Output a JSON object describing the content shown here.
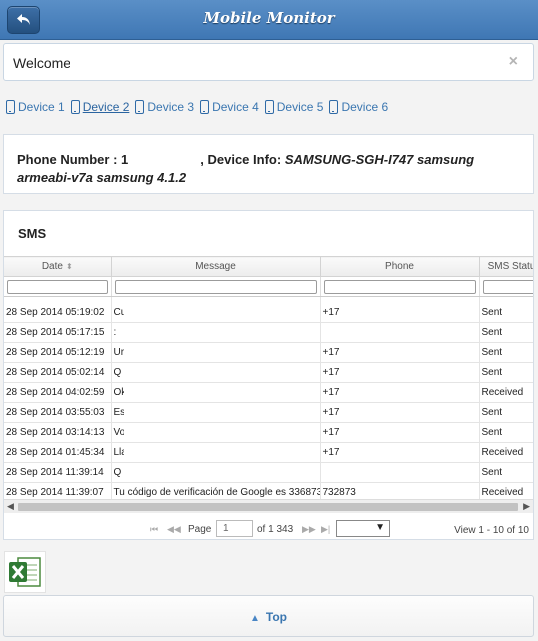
{
  "header": {
    "title": "Mobile Monitor"
  },
  "welcome": {
    "text": "Welcome",
    "close_glyph": "×"
  },
  "devices": [
    {
      "label": "Device 1"
    },
    {
      "label": "Device 2"
    },
    {
      "label": "Device 3"
    },
    {
      "label": "Device 4"
    },
    {
      "label": "Device 5"
    },
    {
      "label": "Device 6"
    }
  ],
  "info": {
    "phone_label": "Phone Number :",
    "phone_value": "1",
    "device_label": ", Device Info:",
    "device_value": "SAMSUNG-SGH-I747 samsung armeabi-v7a samsung 4.1.2"
  },
  "sms": {
    "title": "SMS",
    "columns": [
      "Date",
      "Message",
      "Phone",
      "SMS Status"
    ],
    "sort_glyph": "⬍",
    "rows": [
      {
        "date": "28 Sep 2014 05:19:02",
        "message": "Cuan",
        "phone": "+17",
        "status": "Sent"
      },
      {
        "date": "28 Sep 2014 05:17:15",
        "message": ":",
        "phone": "",
        "status": "Sent"
      },
      {
        "date": "28 Sep 2014 05:12:19",
        "message": "Urb la",
        "phone": "+17",
        "status": "Sent"
      },
      {
        "date": "28 Sep 2014 05:02:14",
        "message": "Q ha",
        "phone": "+17",
        "status": "Sent"
      },
      {
        "date": "28 Sep 2014 04:02:59",
        "message": "Ok",
        "phone": "+17",
        "status": "Received"
      },
      {
        "date": "28 Sep 2014 03:55:03",
        "message": "Estoy",
        "phone": "+17",
        "status": "Sent"
      },
      {
        "date": "28 Sep 2014 03:14:13",
        "message": "Voy a",
        "phone": "+17",
        "status": "Sent"
      },
      {
        "date": "28 Sep 2014 01:45:34",
        "message": "Llama",
        "phone": "+17",
        "status": "Received"
      },
      {
        "date": "28 Sep 2014 11:39:14",
        "message": "Q",
        "phone": "",
        "status": "Sent"
      },
      {
        "date": "28 Sep 2014 11:39:07",
        "message": "Tu código de verificación de Google es 336873",
        "phone": "732873",
        "status": "Received"
      }
    ],
    "pager": {
      "page_label": "Page",
      "page_value": "1",
      "of_label": "of 1 343",
      "view_info": "View 1 - 10 of 10",
      "first_glyph": "⏮",
      "prev_glyph": "◀◀",
      "next_glyph": "▶▶",
      "last_glyph": "▶|"
    }
  },
  "top_button": {
    "label": "Top"
  },
  "colors": {
    "header": "#4a82bf",
    "link": "#3a76b0"
  },
  "icons": [
    "back-icon",
    "close-icon",
    "phone-icon",
    "sort-icon",
    "excel-icon",
    "up-arrow-icon"
  ]
}
